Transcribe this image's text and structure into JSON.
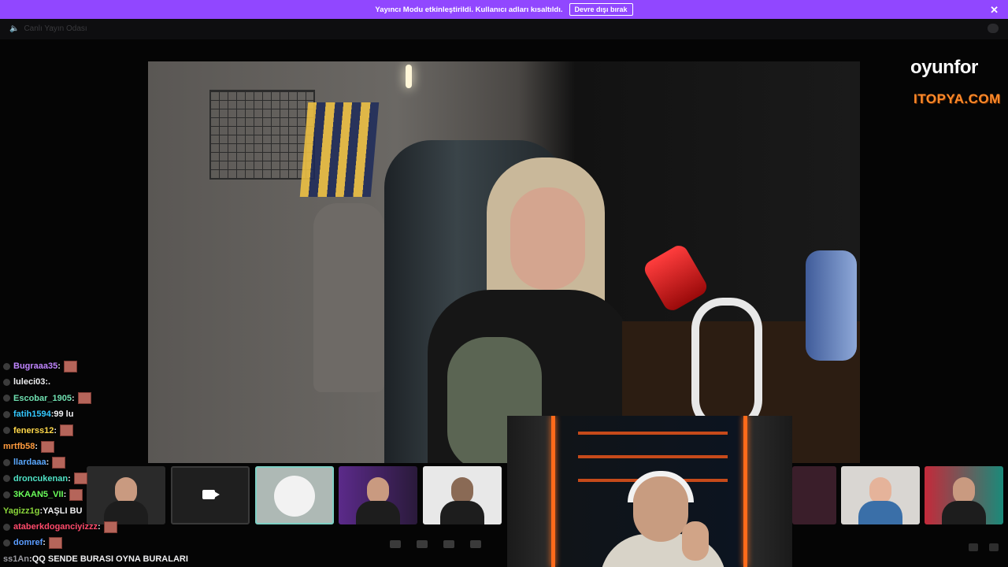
{
  "banner": {
    "message": "Yayıncı Modu etkinleştirildi. Kullanıcı adları kısaltıldı.",
    "button_label": "Devre dışı bırak",
    "close_icon": "✕",
    "color": "#9147ff"
  },
  "topbar": {
    "room_label": "Canlı Yayın Odası",
    "speaker_icon": "speaker-icon",
    "chat_icon": "chat-bubble-icon"
  },
  "logos": {
    "oyunfor": "oyunfor",
    "itopya": "ITOPYA.COM"
  },
  "chat": [
    {
      "user": "Bugraaa35",
      "color": "#c085ff",
      "text": "",
      "emote": true
    },
    {
      "user": "luleci03",
      "color": "#efeff1",
      "text": ".",
      "emote": false
    },
    {
      "user": "Escobar_1905",
      "color": "#6fe0b0",
      "text": "",
      "emote": true
    },
    {
      "user": "fatih1594",
      "color": "#33c8ff",
      "text": "99 lu",
      "emote": false
    },
    {
      "user": "fenerss12",
      "color": "#ffd84a",
      "text": "",
      "emote": true
    },
    {
      "user": "mrtfb58",
      "color": "#ff9a3d",
      "text": "",
      "emote": true
    },
    {
      "user": "llardaaa",
      "color": "#5aa8ff",
      "text": "",
      "emote": true
    },
    {
      "user": "droncukenan",
      "color": "#4fe3c6",
      "text": "",
      "emote": true
    },
    {
      "user": "3KAAN5_VII",
      "color": "#6aff5a",
      "text": "",
      "emote": true
    },
    {
      "user": "Yagizz1g",
      "color": "#8ad63a",
      "text": "YAŞLI BU",
      "emote": false
    },
    {
      "user": "ataberkdoganciyizzz",
      "color": "#ff4a6b",
      "text": "",
      "emote": true
    },
    {
      "user": "domref",
      "color": "#5a9cff",
      "text": "",
      "emote": true
    },
    {
      "user": "ss1An",
      "color": "#9a9aa0",
      "text": "QQ SENDE BURASI OYNA BURALARI",
      "emote": false
    }
  ],
  "participants": [
    {
      "name": "participant-1",
      "kind": "video"
    },
    {
      "name": "camera-off",
      "kind": "camera-off"
    },
    {
      "name": "active-speaker",
      "kind": "avatar"
    },
    {
      "name": "participant-3",
      "kind": "video"
    },
    {
      "name": "participant-4",
      "kind": "video"
    },
    {
      "name": "participant-5",
      "kind": "video"
    },
    {
      "name": "participant-6",
      "kind": "video"
    },
    {
      "name": "participant-7",
      "kind": "video"
    }
  ],
  "controls": [
    "mic-icon",
    "camera-off-icon",
    "screen-share-icon",
    "grid-icon"
  ],
  "corner_controls": [
    "volume-icon",
    "settings-icon"
  ]
}
